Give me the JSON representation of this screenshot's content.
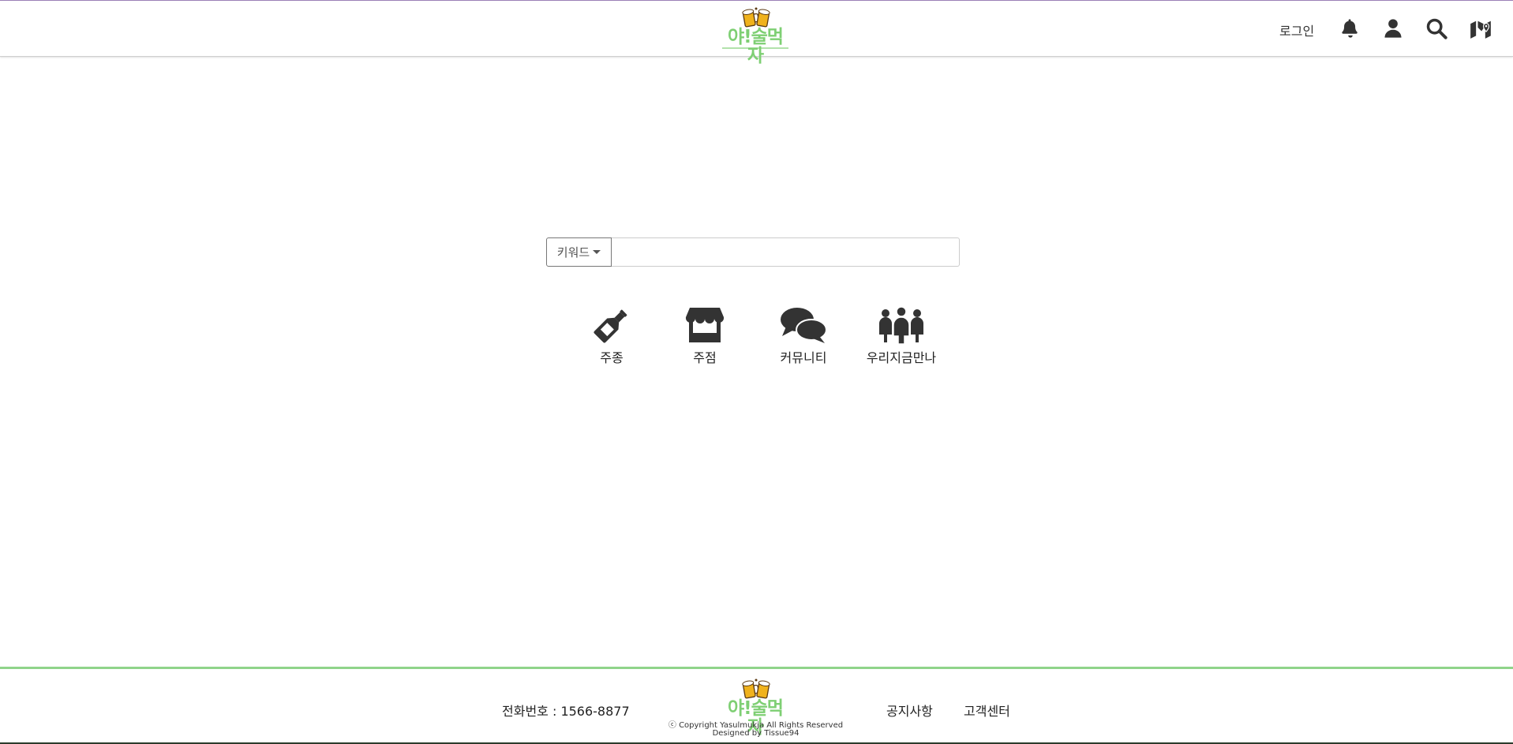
{
  "brand": {
    "wordmark": "야!술먹자",
    "color": "#7ecf73"
  },
  "header": {
    "login_label": "로그인",
    "icons": [
      "bell-icon",
      "user-icon",
      "search-icon",
      "map-icon"
    ]
  },
  "search": {
    "dropdown_label": "키워드",
    "value": "",
    "placeholder": ""
  },
  "categories": [
    {
      "label": "주종",
      "icon": "bottle-icon"
    },
    {
      "label": "주점",
      "icon": "store-icon"
    },
    {
      "label": "커뮤니티",
      "icon": "comments-icon"
    },
    {
      "label": "우리지금만나",
      "icon": "people-group-icon"
    }
  ],
  "footer": {
    "phone": "전화번호 : 1566-8877",
    "copyright": "ⓒ Copyright Yasulmukja All Rights Reserved",
    "designed_by": "Designed by Tissue94",
    "links": [
      "공지사항",
      "고객센터"
    ],
    "accent": "#8fd48a"
  }
}
